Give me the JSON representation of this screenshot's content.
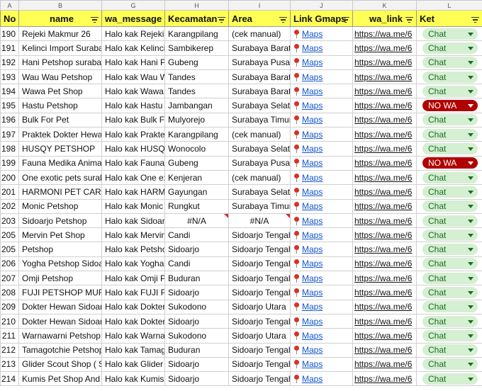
{
  "column_letters": [
    "A",
    "B",
    "G",
    "H",
    "I",
    "J",
    "K",
    "L"
  ],
  "headers": {
    "no": "No",
    "name": "name",
    "wa_message": "wa_message",
    "kecamatan": "Kecamatan",
    "area": "Area",
    "link_gmaps": "Link Gmaps",
    "wa_link": "wa_link",
    "ket": "Ket"
  },
  "maps_label": "Maps",
  "rows": [
    {
      "no": "190",
      "name": "Rejeki Makmur 26",
      "msg": "Halo kak Rejeki M",
      "kec": "Karangpilang",
      "area": "(cek manual)",
      "wa": "https://wa.me/6",
      "ket": "Chat",
      "ket_type": "chat"
    },
    {
      "no": "191",
      "name": "Kelinci Import Surabay",
      "msg": "Halo kak Kelinci I",
      "kec": "Sambikerep",
      "area": "Surabaya Barat",
      "wa": "https://wa.me/6",
      "ket": "Chat",
      "ket_type": "chat"
    },
    {
      "no": "192",
      "name": "Hani Petshop surabay",
      "msg": "Halo kak Hani Pe",
      "kec": "Gubeng",
      "area": "Surabaya Pusat",
      "wa": "https://wa.me/6",
      "ket": "Chat",
      "ket_type": "chat"
    },
    {
      "no": "193",
      "name": "Wau Wau Petshop",
      "msg": "Halo kak Wau W",
      "kec": "Tandes",
      "area": "Surabaya Barat",
      "wa": "https://wa.me/6",
      "ket": "Chat",
      "ket_type": "chat"
    },
    {
      "no": "194",
      "name": "Wawa Pet Shop",
      "msg": "Halo kak Wawa I",
      "kec": "Tandes",
      "area": "Surabaya Barat",
      "wa": "https://wa.me/6",
      "ket": "Chat",
      "ket_type": "chat"
    },
    {
      "no": "195",
      "name": "Hastu Petshop",
      "msg": "Halo kak Hastu P",
      "kec": "Jambangan",
      "area": "Surabaya Selata",
      "wa": "https://wa.me/6",
      "ket": "NO WA",
      "ket_type": "nowa"
    },
    {
      "no": "196",
      "name": "Bulk For Pet",
      "msg": "Halo kak Bulk Fo",
      "kec": "Mulyorejo",
      "area": "Surabaya Timur",
      "wa": "https://wa.me/6",
      "ket": "Chat",
      "ket_type": "chat"
    },
    {
      "no": "197",
      "name": "Praktek Dokter Hewan",
      "msg": "Halo kak Praktek",
      "kec": "Karangpilang",
      "area": "(cek manual)",
      "wa": "https://wa.me/6",
      "ket": "Chat",
      "ket_type": "chat"
    },
    {
      "no": "198",
      "name": "HUSQY PETSHOP",
      "msg": "Halo kak HUSQY",
      "kec": "Wonocolo",
      "area": "Surabaya Selata",
      "wa": "https://wa.me/6",
      "ket": "Chat",
      "ket_type": "chat"
    },
    {
      "no": "199",
      "name": "Fauna Medika Animal",
      "msg": "Halo kak Fauna M",
      "kec": "Gubeng",
      "area": "Surabaya Pusat",
      "wa": "https://wa.me/6",
      "ket": "NO WA",
      "ket_type": "nowa"
    },
    {
      "no": "200",
      "name": "One exotic pets surab",
      "msg": "Halo kak One ex",
      "kec": "Kenjeran",
      "area": "(cek manual)",
      "wa": "https://wa.me/6",
      "ket": "Chat",
      "ket_type": "chat"
    },
    {
      "no": "201",
      "name": "HARMONI PET CARE",
      "msg": "Halo kak HARMO",
      "kec": "Gayungan",
      "area": "Surabaya Selata",
      "wa": "https://wa.me/6",
      "ket": "Chat",
      "ket_type": "chat"
    },
    {
      "no": "202",
      "name": "Monic Petshop",
      "msg": "Halo kak Monic I",
      "kec": "Rungkut",
      "area": "Surabaya Timur",
      "wa": "https://wa.me/6",
      "ket": "Chat",
      "ket_type": "chat"
    },
    {
      "no": "203",
      "name": "Sidoarjo Petshop",
      "msg": "Halo kak Sidoarj",
      "kec": "#N/A",
      "area": "#N/A",
      "wa": "https://wa.me/6",
      "ket": "Chat",
      "ket_type": "chat",
      "error": true
    },
    {
      "no": "205",
      "name": "Mervin Pet Shop",
      "msg": "Halo kak Mervin",
      "kec": "Candi",
      "area": "Sidoarjo Tengah",
      "wa": "https://wa.me/6",
      "ket": "Chat",
      "ket_type": "chat"
    },
    {
      "no": "205",
      "name": "Petshop",
      "msg": "Halo kak Petsho",
      "kec": "Sidoarjo",
      "area": "Sidoarjo Tengah",
      "wa": "https://wa.me/6",
      "ket": "Chat",
      "ket_type": "chat"
    },
    {
      "no": "206",
      "name": "Yogha Petshop Sidoar",
      "msg": "Halo kak Yogha P",
      "kec": "Candi",
      "area": "Sidoarjo Tengah",
      "wa": "https://wa.me/6",
      "ket": "Chat",
      "ket_type": "chat"
    },
    {
      "no": "207",
      "name": "Omji Petshop",
      "msg": "Halo kak Omji Pe",
      "kec": "Buduran",
      "area": "Sidoarjo Tengah",
      "wa": "https://wa.me/6",
      "ket": "Chat",
      "ket_type": "chat"
    },
    {
      "no": "208",
      "name": "FUJI PETSHOP MURAH",
      "msg": "Halo kak FUJI PE",
      "kec": "Sidoarjo",
      "area": "Sidoarjo Tengah",
      "wa": "https://wa.me/6",
      "ket": "Chat",
      "ket_type": "chat"
    },
    {
      "no": "209",
      "name": "Dokter Hewan Sidoarj",
      "msg": "Halo kak Dokter",
      "kec": "Sukodono",
      "area": "Sidoarjo Utara",
      "wa": "https://wa.me/6",
      "ket": "Chat",
      "ket_type": "chat"
    },
    {
      "no": "210",
      "name": "Dokter Hewan Sidoarj",
      "msg": "Halo kak Dokter",
      "kec": "Sidoarjo",
      "area": "Sidoarjo Tengah",
      "wa": "https://wa.me/6",
      "ket": "Chat",
      "ket_type": "chat"
    },
    {
      "no": "211",
      "name": "Warnawarni Petshop",
      "msg": "Halo kak Warnav",
      "kec": "Sukodono",
      "area": "Sidoarjo Utara",
      "wa": "https://wa.me/6",
      "ket": "Chat",
      "ket_type": "chat"
    },
    {
      "no": "212",
      "name": "Tamagotchie Petshop",
      "msg": "Halo kak Tamago",
      "kec": "Buduran",
      "area": "Sidoarjo Tengah",
      "wa": "https://wa.me/6",
      "ket": "Chat",
      "ket_type": "chat"
    },
    {
      "no": "213",
      "name": "Glider Scout Shop ( S",
      "msg": "Halo kak Glider S",
      "kec": "Sidoarjo",
      "area": "Sidoarjo Tengah",
      "wa": "https://wa.me/6",
      "ket": "Chat",
      "ket_type": "chat"
    },
    {
      "no": "214",
      "name": "Kumis Pet Shop And A",
      "msg": "Halo kak Kumis P",
      "kec": "Sidoarjo",
      "area": "Sidoarjo Tengah",
      "wa": "https://wa.me/6",
      "ket": "Chat",
      "ket_type": "chat"
    }
  ]
}
